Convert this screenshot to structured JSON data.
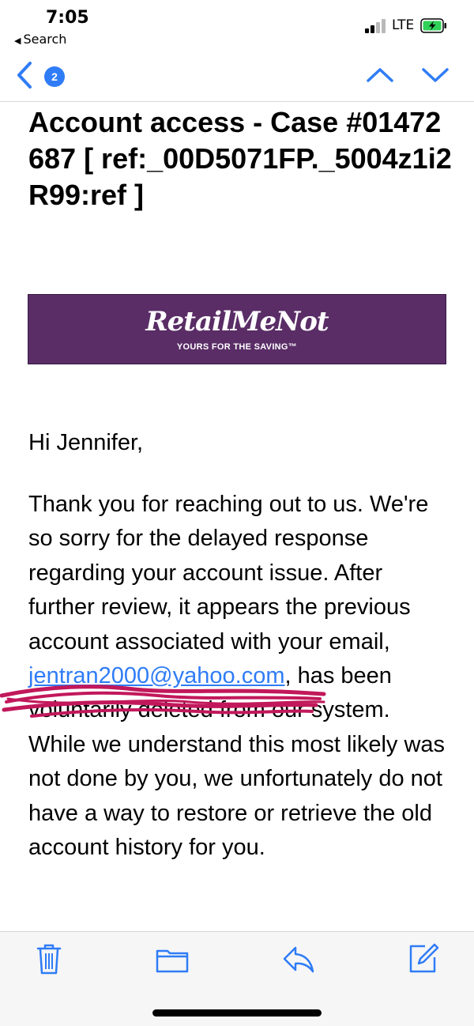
{
  "status_bar": {
    "time": "7:05",
    "back_app": "Search",
    "network": "LTE",
    "battery_state": "charging"
  },
  "nav": {
    "unread_count": "2",
    "icons": [
      "chevron-left-icon",
      "chevron-up-icon",
      "chevron-down-icon"
    ]
  },
  "email": {
    "subject": "Account access - Case #01472687 [ ref:_00D5071FP._5004z1i2R99:ref ]",
    "banner": {
      "brand": "RetailMeNot",
      "tagline": "YOURS FOR THE SAVING™",
      "background": "#5a2d66"
    },
    "greeting": "Hi Jennifer,",
    "body_part1": "Thank you for reaching out to us. We're so sorry for the delayed response regarding your account issue. After further review, it appears the previous account associated with your email, ",
    "email_link": "jentran2000@yahoo.com",
    "body_part2": ", has been voluntarily deleted from our system. While we understand this most likely was not done by you, we unfortunately do not have a way to restore or retrieve the old account history for you."
  },
  "toolbar": {
    "icons": [
      "trash-icon",
      "folder-icon",
      "reply-icon",
      "compose-icon"
    ]
  },
  "colors": {
    "accent": "#2f7cf6",
    "scribble": "#c2185b"
  }
}
